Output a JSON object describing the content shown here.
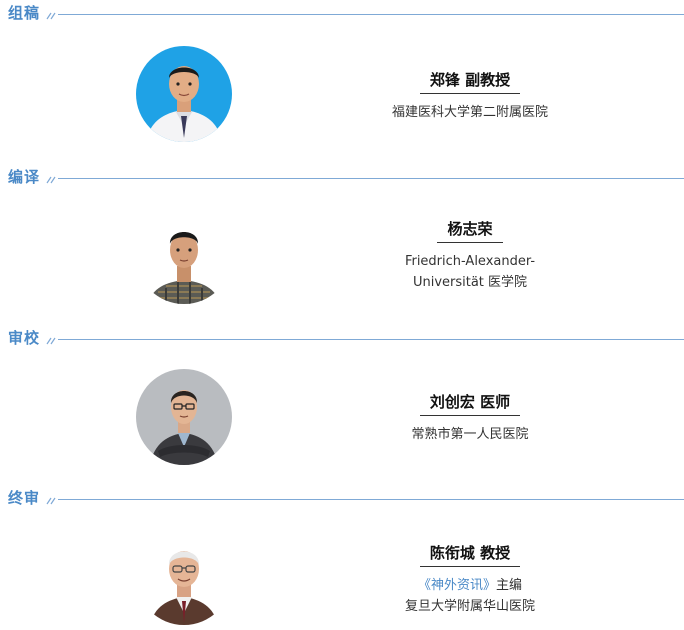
{
  "sections": [
    {
      "title": "组稿",
      "person": {
        "name": "郑锋 副教授",
        "affiliation_lines": [
          "福建医科大学第二附属医院"
        ]
      },
      "avatar_icon": "portrait-man-white-coat"
    },
    {
      "title": "编译",
      "person": {
        "name": "杨志荣",
        "affiliation_lines": [
          "Friedrich-Alexander-",
          "Universität 医学院"
        ]
      },
      "avatar_icon": "portrait-man-plaid-shirt"
    },
    {
      "title": "审校",
      "person": {
        "name": "刘创宏 医师",
        "affiliation_lines": [
          "常熟市第一人民医院"
        ]
      },
      "avatar_icon": "portrait-man-glasses-crossed-arms"
    },
    {
      "title": "终审",
      "person": {
        "name": "陈衔城 教授",
        "affiliation_link": "《神外资讯》",
        "affiliation_link_suffix": "主编",
        "affiliation_lines": [
          "复旦大学附属华山医院"
        ]
      },
      "avatar_icon": "portrait-elderly-man-glasses"
    }
  ],
  "colors": {
    "accent": "#4a89c7",
    "divider": "#7fa9d6",
    "avatar1_bg": "#1fa2e6",
    "avatar3_bg": "#b9bcc0"
  }
}
